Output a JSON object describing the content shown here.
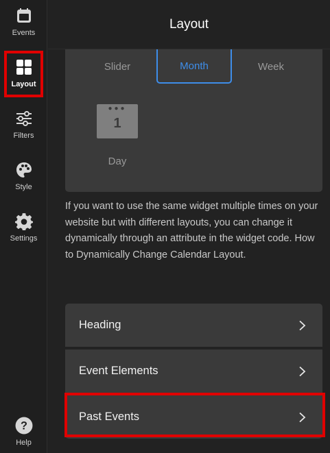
{
  "sidebar": {
    "items": [
      {
        "label": "Events",
        "icon": "calendar-icon"
      },
      {
        "label": "Layout",
        "icon": "layout-grid-icon",
        "active": true
      },
      {
        "label": "Filters",
        "icon": "sliders-icon"
      },
      {
        "label": "Style",
        "icon": "palette-icon"
      },
      {
        "label": "Settings",
        "icon": "gear-icon"
      }
    ],
    "help": {
      "label": "Help",
      "icon": "question-icon"
    }
  },
  "header": {
    "title": "Layout"
  },
  "layout_options": {
    "slider": "Slider",
    "month": "Month",
    "week": "Week",
    "day": "Day",
    "day_icon_number": "1",
    "selected": "Month"
  },
  "description": "If you want to use the same widget multiple times on your website but with different layouts, you can change it dynamically through an attribute in the widget code. How to Dynamically Change Calendar Layout.",
  "sections": [
    {
      "label": "Heading"
    },
    {
      "label": "Event Elements"
    },
    {
      "label": "Past Events"
    }
  ],
  "colors": {
    "accent": "#3e8eea",
    "highlight": "#e00000",
    "panel": "#3a3a3a",
    "background": "#222222"
  }
}
